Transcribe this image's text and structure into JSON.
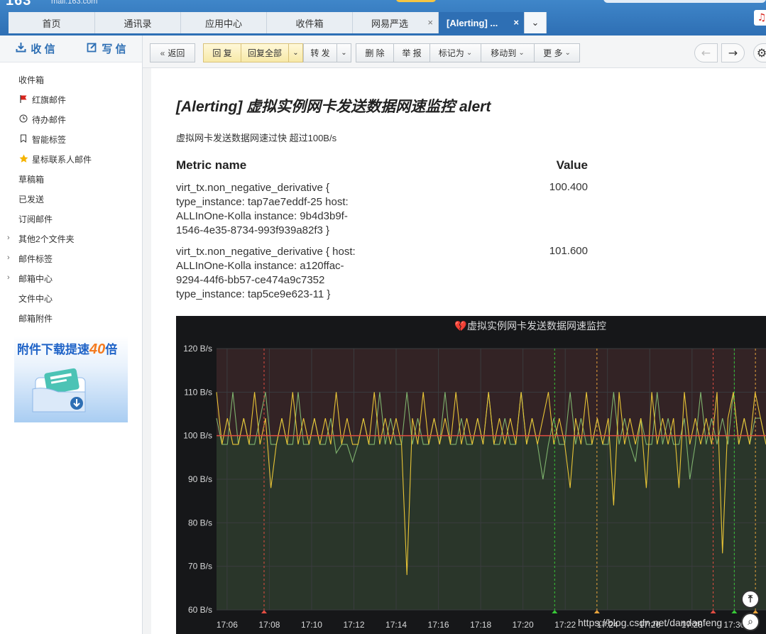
{
  "header": {
    "logo": "163",
    "logo_sub": "mail.163.com",
    "tabs": [
      {
        "label": "首页"
      },
      {
        "label": "通讯录"
      },
      {
        "label": "应用中心"
      },
      {
        "label": "收件箱"
      },
      {
        "label": "网易严选",
        "closable": true
      },
      {
        "label": "[Alerting] ...",
        "closable": true,
        "active": true
      }
    ],
    "close_glyph": "×",
    "more_glyph": "⌄"
  },
  "sidebar": {
    "receive_label": "收 信",
    "write_label": "写 信",
    "folders": [
      {
        "label": "收件箱"
      },
      {
        "label": "红旗邮件",
        "icon": "flag-icon",
        "icon_color": "#d8261e"
      },
      {
        "label": "待办邮件",
        "icon": "clock-icon"
      },
      {
        "label": "智能标签",
        "icon": "bookmark-icon"
      },
      {
        "label": "星标联系人邮件",
        "icon": "star-icon",
        "icon_color": "#f5b400"
      },
      {
        "label": "草稿箱"
      },
      {
        "label": "已发送"
      },
      {
        "label": "订阅邮件"
      },
      {
        "label": "其他2个文件夹",
        "expandable": true
      },
      {
        "label": "邮件标签",
        "expandable": true
      },
      {
        "label": "邮箱中心",
        "expandable": true
      },
      {
        "label": "文件中心"
      },
      {
        "label": "邮箱附件"
      }
    ],
    "promo": {
      "text": "附件下载提速",
      "number": "40",
      "suffix": "倍"
    }
  },
  "toolbar": {
    "back": "返回",
    "reply": "回 复",
    "reply_all": "回复全部",
    "forward": "转 发",
    "delete": "删 除",
    "report": "举 报",
    "mark_as": "标记为",
    "move_to": "移动到",
    "more": "更 多"
  },
  "email": {
    "subject": "[Alerting] 虚拟实例网卡发送数据网速监控 alert",
    "description": "虚拟网卡发送数据网速过快 超过100B/s",
    "table_headers": {
      "metric": "Metric name",
      "value": "Value"
    },
    "metrics": [
      {
        "lines": [
          "virt_tx.non_negative_derivative {",
          "type_instance: tap7ae7eddf-25 host:",
          "ALLInOne-Kolla instance: 9b4d3b9f-",
          "1546-4e35-8734-993f939a82f3 }"
        ],
        "value": "100.400"
      },
      {
        "lines": [
          "virt_tx.non_negative_derivative { host:",
          "ALLInOne-Kolla instance: a120ffac-",
          "9294-44f6-bb57-ce474a9c7352",
          "type_instance: tap5ce9e623-11 }"
        ],
        "value": "101.600"
      }
    ]
  },
  "colors": {
    "brand_blue": "#2e6fb4",
    "chart_bg": "#161719",
    "threshold": "#e24d42",
    "series_yellow": "#e8c436",
    "series_green": "#7eb26d"
  },
  "chart_data": {
    "type": "line",
    "title": "虚拟实例网卡发送数据网速监控",
    "title_icon": "broken-heart-icon",
    "y_unit": "B/s",
    "ylim": [
      60,
      120
    ],
    "yticks": [
      60,
      70,
      80,
      90,
      100,
      110,
      120
    ],
    "ytick_labels": [
      "60 B/s",
      "70 B/s",
      "80 B/s",
      "90 B/s",
      "100 B/s",
      "110 B/s",
      "120 B/s"
    ],
    "xlim": [
      "17:05:30",
      "17:31:30"
    ],
    "xtick_labels": [
      "17:06",
      "17:08",
      "17:10",
      "17:12",
      "17:14",
      "17:16",
      "17:18",
      "17:20",
      "17:22",
      "17:24",
      "17:26",
      "17:28",
      "17:30"
    ],
    "threshold": 100,
    "threshold_alert_band": [
      100,
      120
    ],
    "annotations": [
      {
        "time": "17:07:45",
        "color": "red"
      },
      {
        "time": "17:21:30",
        "color": "green"
      },
      {
        "time": "17:23:30",
        "color": "orange"
      },
      {
        "time": "17:29:00",
        "color": "red"
      },
      {
        "time": "17:30:00",
        "color": "green"
      },
      {
        "time": "17:31:00",
        "color": "orange"
      }
    ],
    "series": [
      {
        "color": "#7eb26d",
        "base": 98,
        "samples": [
          104,
          98,
          98,
          110,
          98,
          104,
          98,
          98,
          104,
          110,
          98,
          98,
          104,
          98,
          98,
          110,
          98,
          98,
          104,
          98,
          98,
          104,
          96,
          98,
          98,
          94,
          98,
          104,
          98,
          98,
          110,
          98,
          104,
          98,
          98,
          110,
          98,
          104,
          98,
          98,
          104,
          98,
          110,
          98,
          98,
          104,
          98,
          98,
          104,
          98,
          110,
          98,
          98,
          104,
          98,
          98,
          110,
          98,
          104,
          98,
          90,
          98,
          104,
          98,
          98,
          110,
          98,
          104,
          98,
          98,
          104,
          98,
          98,
          110,
          98,
          104,
          98,
          94,
          104,
          98,
          98,
          110,
          98,
          104,
          98,
          98,
          104,
          90,
          98,
          110,
          98,
          104,
          98,
          104,
          98,
          110,
          98,
          104,
          98,
          104,
          104,
          98
        ]
      },
      {
        "color": "#e8c436",
        "base": 98,
        "samples": [
          110,
          98,
          104,
          98,
          98,
          104,
          98,
          110,
          98,
          104,
          88,
          98,
          104,
          98,
          110,
          98,
          104,
          98,
          104,
          98,
          104,
          98,
          110,
          98,
          104,
          98,
          98,
          104,
          98,
          110,
          98,
          104,
          98,
          104,
          98,
          68,
          104,
          98,
          110,
          98,
          104,
          98,
          104,
          98,
          110,
          98,
          104,
          98,
          104,
          98,
          110,
          98,
          104,
          98,
          104,
          98,
          110,
          98,
          104,
          98,
          104,
          110,
          98,
          104,
          98,
          88,
          104,
          98,
          110,
          98,
          104,
          98,
          104,
          84,
          110,
          98,
          104,
          98,
          104,
          88,
          110,
          98,
          104,
          98,
          104,
          88,
          110,
          98,
          104,
          98,
          104,
          98,
          110,
          73,
          104,
          110,
          98,
          104,
          98,
          110,
          104,
          98
        ]
      }
    ],
    "watermark": "https://blog.csdn.net/dandanfeng"
  }
}
